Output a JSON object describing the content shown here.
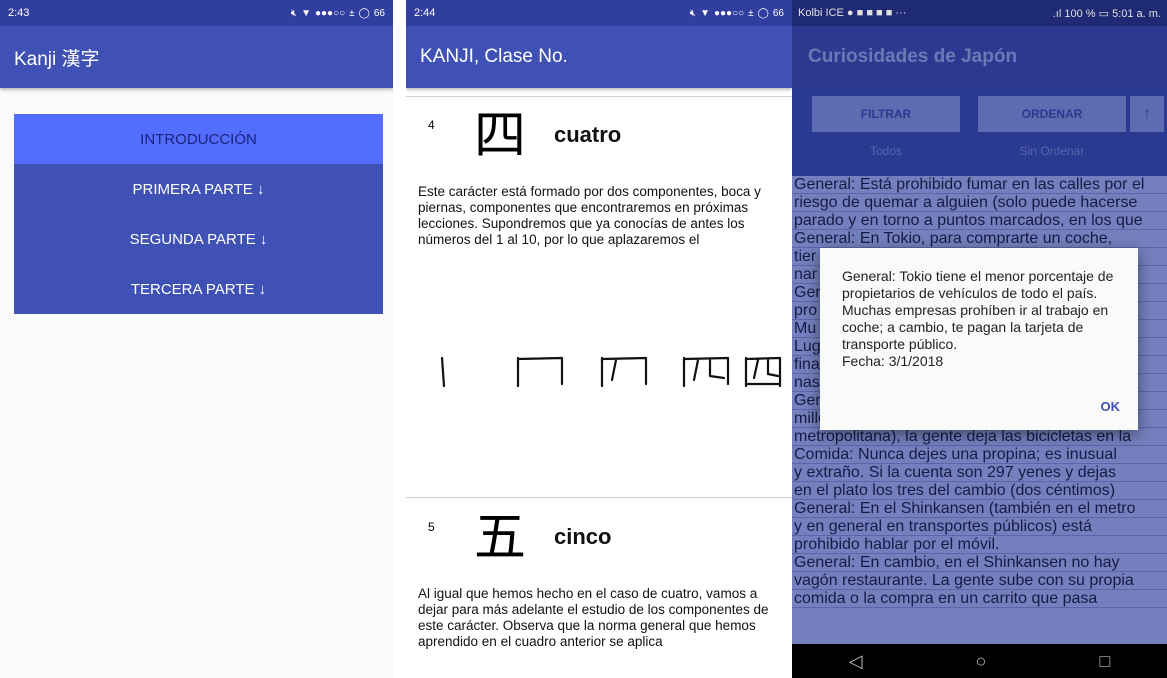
{
  "phone1": {
    "status": {
      "time": "2:43",
      "battery": "66"
    },
    "appbar": {
      "title": "Kanji 漢字"
    },
    "menu": [
      {
        "label": "INTRODUCCIÓN"
      },
      {
        "label": "PRIMERA PARTE ↓"
      },
      {
        "label": "SEGUNDA PARTE ↓"
      },
      {
        "label": "TERCERA PARTE ↓"
      }
    ]
  },
  "phone2": {
    "status": {
      "time": "2:44",
      "battery": "66"
    },
    "appbar": {
      "title": "KANJI, Clase No."
    },
    "cards": [
      {
        "number": "4",
        "kanji": "四",
        "word": "cuatro",
        "text": "Este carácter está formado por dos componentes, boca y piernas, componentes que encontraremos en próximas lecciones. Supondremos que ya conocías de antes los números del 1 al 10, por lo que aplazaremos el"
      },
      {
        "number": "5",
        "kanji": "五",
        "word": "cinco",
        "text": "Al igual que hemos hecho en el caso de cuatro, vamos a dejar para más adelante el estudio de los componentes de este carácter. Observa que la norma general que hemos aprendido en el cuadro anterior se aplica"
      }
    ]
  },
  "phone3": {
    "status": {
      "carrier": "Kolbi ICE",
      "signal": "100 %",
      "time": "5:01 a. m."
    },
    "appbar": {
      "title": "Curiosidades de Japón"
    },
    "filter_label": "FILTRAR",
    "order_label": "ORDENAR",
    "sort_arrow": "↑",
    "filter_value": "Todos",
    "order_value": "Sin Ordenar",
    "list": [
      "General: Está prohibido fumar en las calles por el",
      "riesgo de quemar a alguien (solo puede hacerse",
      "parado y en torno a puntos marcados, en los que",
      "General: En Tokio, para comprarte un coche,",
      "tier",
      "nar",
      "Ger",
      "pro",
      "Mu",
      "Lug",
      "fina",
      "nas",
      "Ger",
      "millones de habitantes (36 si contamos el área",
      "metropolitana), la gente deja las bicicletas en la",
      "Comida: Nunca dejes una propina; es inusual",
      "y extraño. Si la cuenta son 297 yenes y dejas",
      "en el plato los tres del cambio (dos céntimos)",
      "General: En el Shinkansen (también en el metro",
      "y en general en transportes públicos) está",
      "prohibido hablar por el móvil.",
      "General: En cambio, en el Shinkansen no hay",
      "vagón restaurante. La gente sube con su propia",
      "comida o la compra en un carrito que pasa"
    ],
    "dialog": {
      "text": "General: Tokio tiene el menor porcentaje de propietarios de vehículos de todo el país. Muchas empresas prohíben ir al trabajo en coche; a cambio, te pagan la tarjeta de transporte público.",
      "date": "Fecha: 3/1/2018",
      "ok_label": "OK"
    }
  }
}
